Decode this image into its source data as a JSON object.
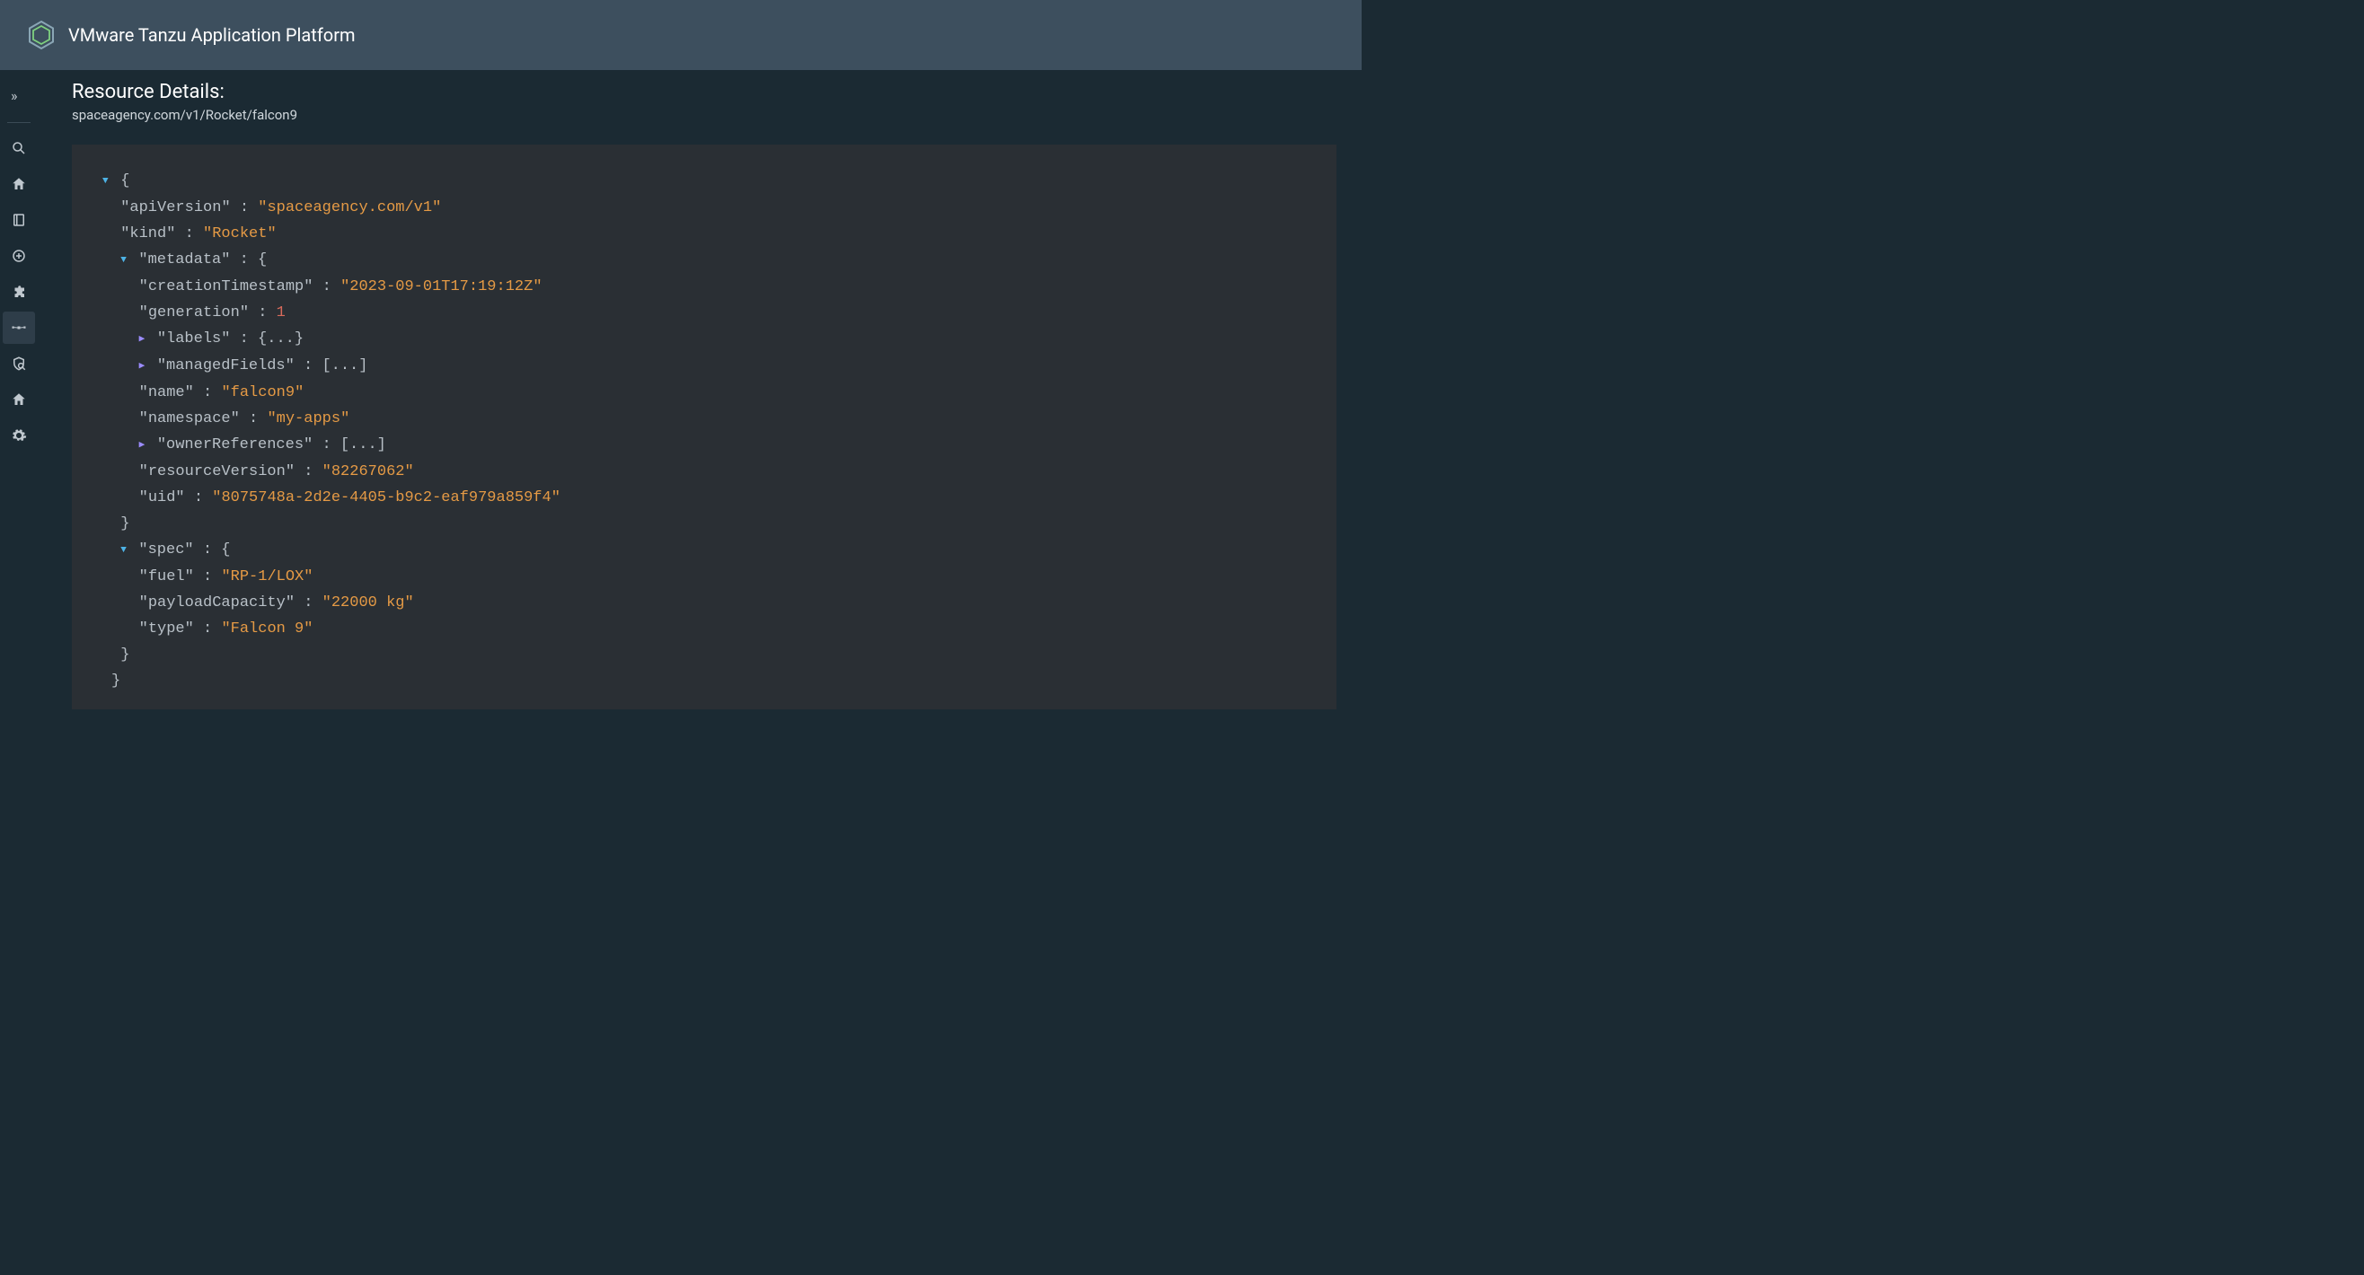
{
  "header": {
    "title": "VMware Tanzu Application Platform"
  },
  "sidebar": {
    "expand": "»",
    "items": [
      {
        "id": "search",
        "icon": "search"
      },
      {
        "id": "home",
        "icon": "home"
      },
      {
        "id": "catalog",
        "icon": "book"
      },
      {
        "id": "create",
        "icon": "plus-circle"
      },
      {
        "id": "plugins",
        "icon": "puzzle"
      },
      {
        "id": "resources",
        "icon": "cluster",
        "active": true
      },
      {
        "id": "security",
        "icon": "shield-search"
      },
      {
        "id": "home2",
        "icon": "home"
      },
      {
        "id": "settings",
        "icon": "gear"
      }
    ]
  },
  "page": {
    "title": "Resource Details:",
    "subtitle": "spaceagency.com/v1/Rocket/falcon9"
  },
  "json": {
    "apiVersion_key": "apiVersion",
    "apiVersion_val": "spaceagency.com/v1",
    "kind_key": "kind",
    "kind_val": "Rocket",
    "metadata_key": "metadata",
    "creationTimestamp_key": "creationTimestamp",
    "creationTimestamp_val": "2023-09-01T17:19:12Z",
    "generation_key": "generation",
    "generation_val": "1",
    "labels_key": "labels",
    "labels_collapsed": "{...}",
    "managedFields_key": "managedFields",
    "managedFields_collapsed": "[...]",
    "name_key": "name",
    "name_val": "falcon9",
    "namespace_key": "namespace",
    "namespace_val": "my-apps",
    "ownerReferences_key": "ownerReferences",
    "ownerReferences_collapsed": "[...]",
    "resourceVersion_key": "resourceVersion",
    "resourceVersion_val": "82267062",
    "uid_key": "uid",
    "uid_val": "8075748a-2d2e-4405-b9c2-eaf979a859f4",
    "spec_key": "spec",
    "fuel_key": "fuel",
    "fuel_val": "RP-1/LOX",
    "payloadCapacity_key": "payloadCapacity",
    "payloadCapacity_val": "22000 kg",
    "type_key": "type",
    "type_val": "Falcon 9"
  }
}
